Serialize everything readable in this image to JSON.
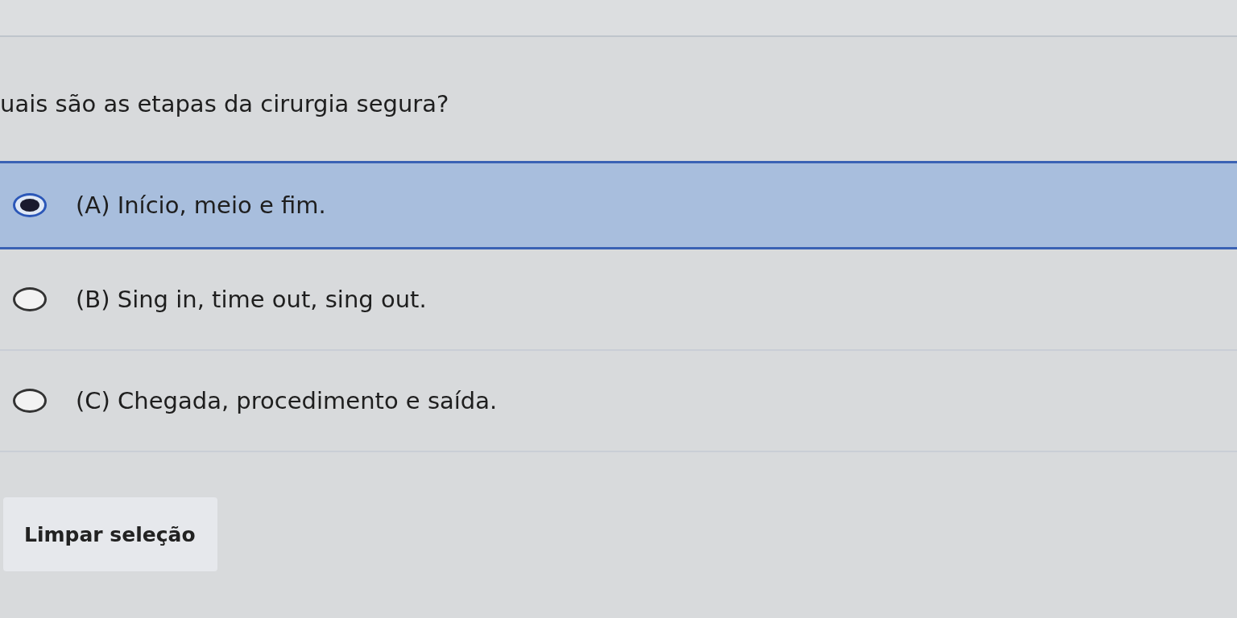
{
  "question": "uais são as etapas da cirurgia segura?",
  "options": [
    {
      "label": "(A) Início, meio e fim.",
      "selected": true
    },
    {
      "label": "(B) Sing in, time out, sing out.",
      "selected": false
    },
    {
      "label": "(C) Chegada, procedimento e saída.",
      "selected": false
    }
  ],
  "clear_button": "Limpar seleção"
}
